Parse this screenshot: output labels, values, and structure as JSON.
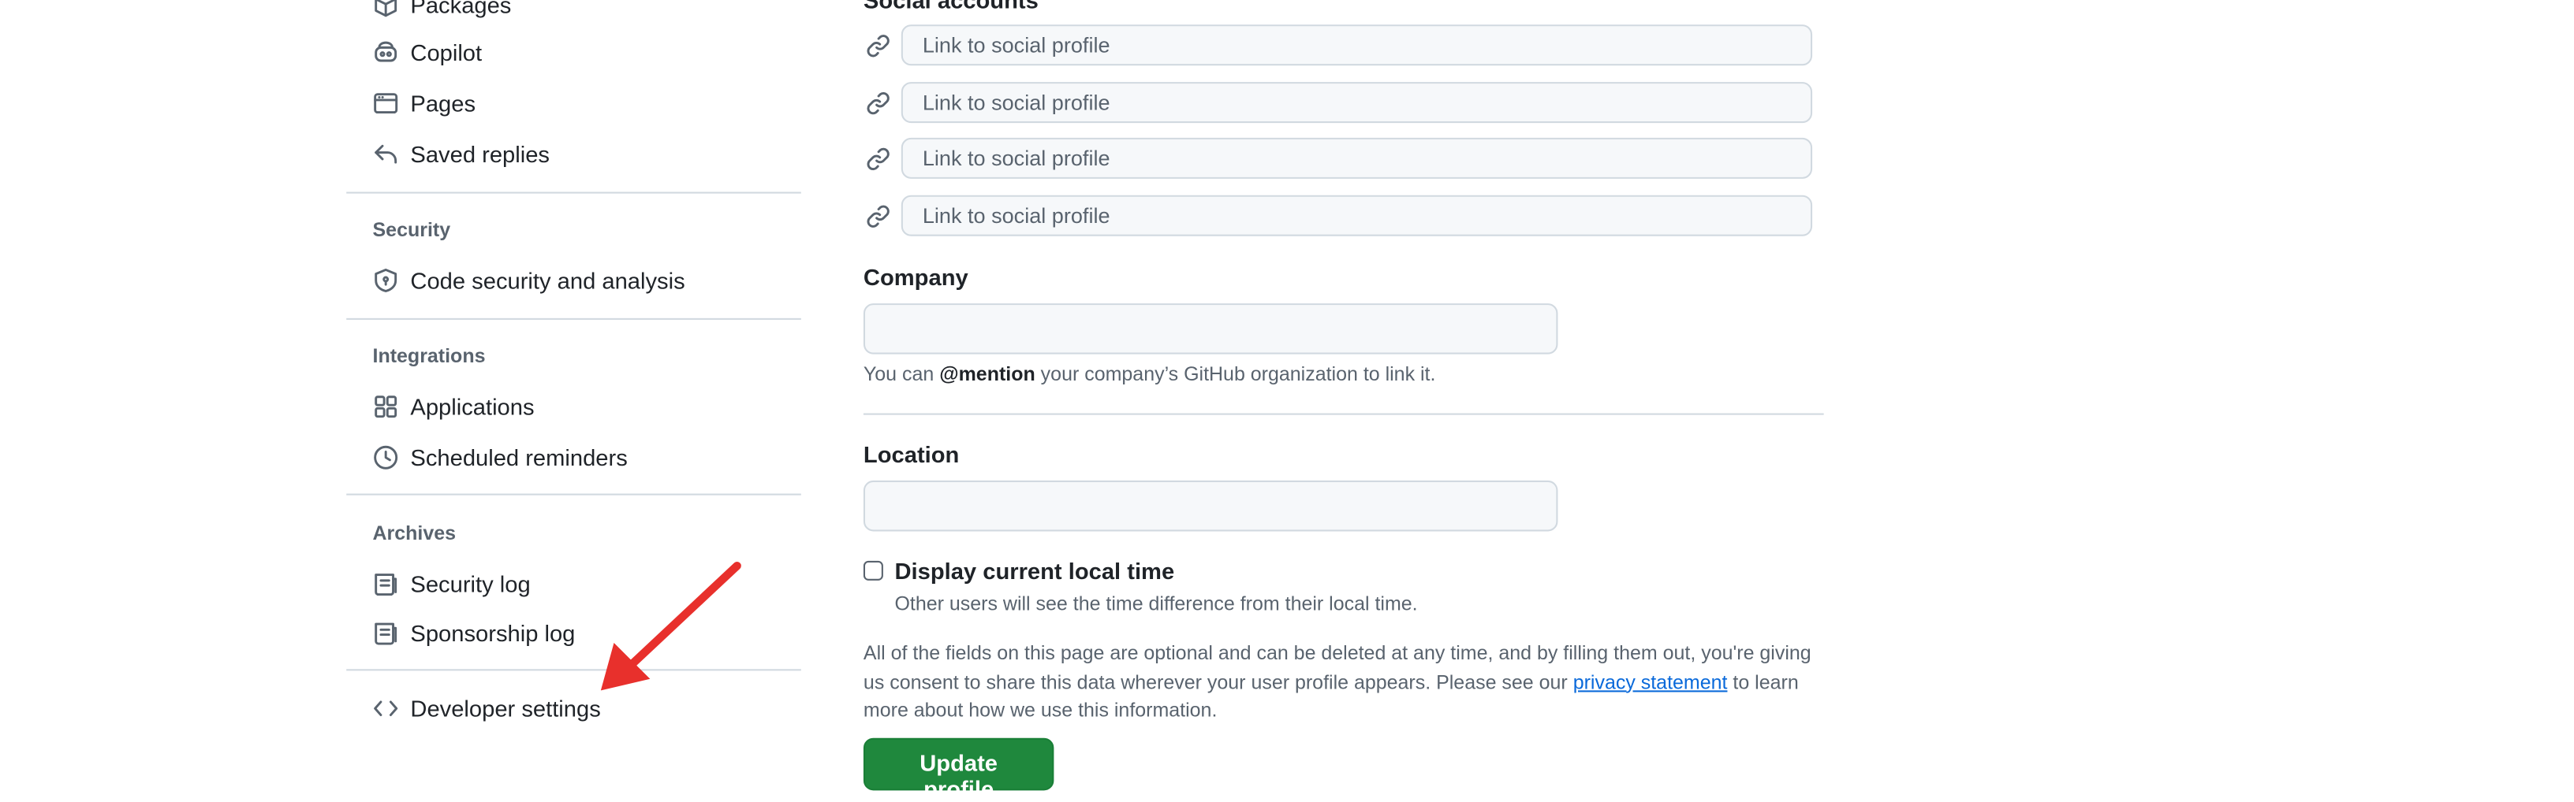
{
  "sidebar": {
    "items_top": [
      {
        "label": "Packages",
        "icon": "package-icon"
      },
      {
        "label": "Copilot",
        "icon": "copilot-icon"
      },
      {
        "label": "Pages",
        "icon": "browser-icon"
      },
      {
        "label": "Saved replies",
        "icon": "reply-icon"
      }
    ],
    "security": {
      "heading": "Security",
      "items": [
        {
          "label": "Code security and analysis",
          "icon": "shield-lock-icon"
        }
      ]
    },
    "integrations": {
      "heading": "Integrations",
      "items": [
        {
          "label": "Applications",
          "icon": "apps-icon"
        },
        {
          "label": "Scheduled reminders",
          "icon": "clock-icon"
        }
      ]
    },
    "archives": {
      "heading": "Archives",
      "items": [
        {
          "label": "Security log",
          "icon": "log-icon"
        },
        {
          "label": "Sponsorship log",
          "icon": "log-icon"
        }
      ]
    },
    "developer": {
      "label": "Developer settings",
      "icon": "code-icon"
    }
  },
  "main": {
    "social": {
      "heading": "Social accounts",
      "placeholder": "Link to social profile",
      "icon": "link-icon"
    },
    "company": {
      "label": "Company",
      "value": "",
      "note_prefix": "You can ",
      "note_mention": "@mention",
      "note_suffix": " your company’s GitHub organization to link it."
    },
    "location": {
      "label": "Location",
      "value": ""
    },
    "local_time": {
      "label": "Display current local time",
      "checked": false,
      "description": "Other users will see the time difference from their local time."
    },
    "disclaimer": {
      "text_before": "All of the fields on this page are optional and can be deleted at any time, and by filling them out, you're giving us consent to share this data wherever your user profile appears. Please see our ",
      "link": "privacy statement",
      "text_after": " to learn more about how we use this information."
    },
    "update_button": "Update profile"
  },
  "annotation": {
    "arrow_color": "#e8302c"
  },
  "colors": {
    "accent": "#0969da",
    "primary_button": "#1f883d"
  }
}
